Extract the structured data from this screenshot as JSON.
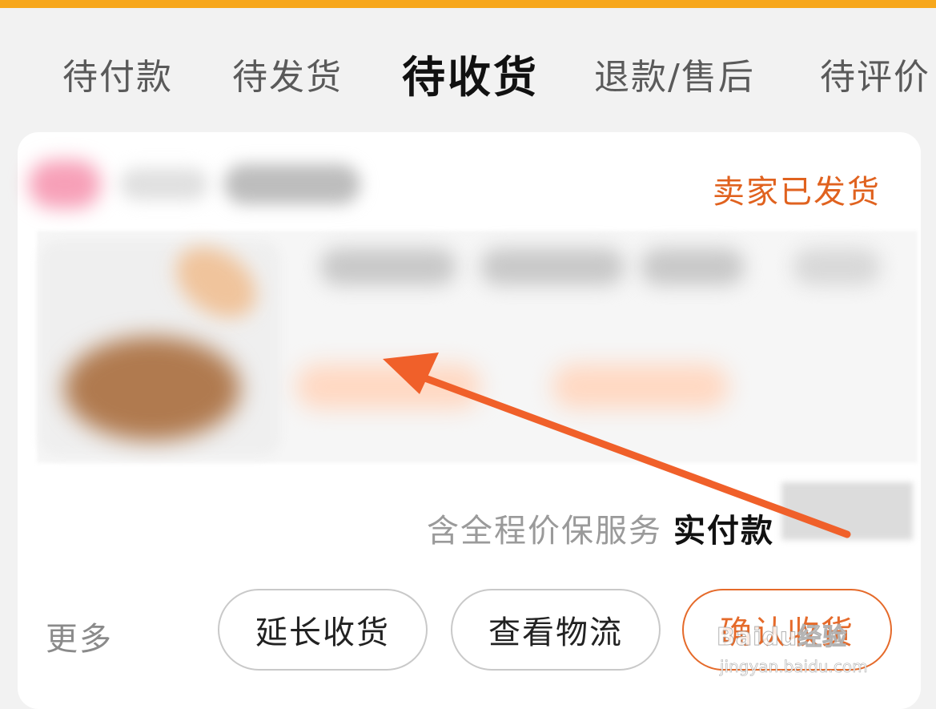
{
  "tabs": [
    {
      "label": "待付款"
    },
    {
      "label": "待发货"
    },
    {
      "label": "待收货",
      "active": true
    },
    {
      "label": "退款/售后"
    },
    {
      "label": "待评价"
    }
  ],
  "order": {
    "status": "卖家已发货",
    "price_note": "含全程价保服务",
    "price_label": "实付款"
  },
  "actions": {
    "more": "更多",
    "extend_receipt": "延长收货",
    "view_logistics": "查看物流",
    "confirm_receipt": "确认收货"
  },
  "watermark": {
    "brand": "Baidu经验",
    "url": "jingyan.baidu.com"
  },
  "colors": {
    "accent": "#f7a71c",
    "status": "#e0621f",
    "annotation_arrow": "#f0602a"
  },
  "icons": {
    "annotation": "arrow-icon"
  }
}
